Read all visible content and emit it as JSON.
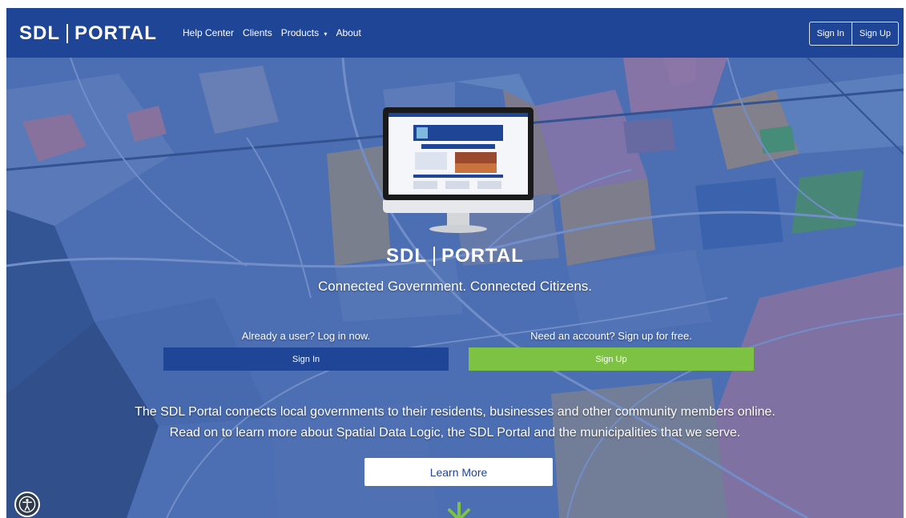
{
  "nav": {
    "brand_left": "SDL",
    "brand_right": "PORTAL",
    "links": [
      {
        "label": "Help Center"
      },
      {
        "label": "Clients"
      },
      {
        "label": "Products",
        "caret": "▾"
      },
      {
        "label": "About"
      }
    ],
    "signin_label": "Sign In",
    "signup_label": "Sign Up"
  },
  "hero": {
    "logo_left": "SDL",
    "logo_right": "PORTAL",
    "tagline": "Connected Government. Connected Citizens.",
    "login_prompt": "Already a user? Log in now.",
    "signup_prompt": "Need an account? Sign up for free.",
    "signin_button": "Sign In",
    "signup_button": "Sign Up",
    "description_line1": "The SDL Portal connects local governments to their residents, businesses and other community members online.",
    "description_line2": "Read on to learn more about Spatial Data Logic, the SDL Portal and the municipalities that we serve.",
    "learn_more": "Learn More"
  },
  "icons": {
    "accessibility": "accessibility-icon",
    "scroll_down": "down-arrow-icon",
    "monitor": "monitor-icon",
    "dropdown": "chevron-down-icon"
  },
  "colors": {
    "navbar": "#1f4597",
    "signin_button": "#1f4597",
    "signup_button": "#7dc243",
    "map_overlay": "#3b62b0",
    "learn_more_text": "#1f4597"
  }
}
